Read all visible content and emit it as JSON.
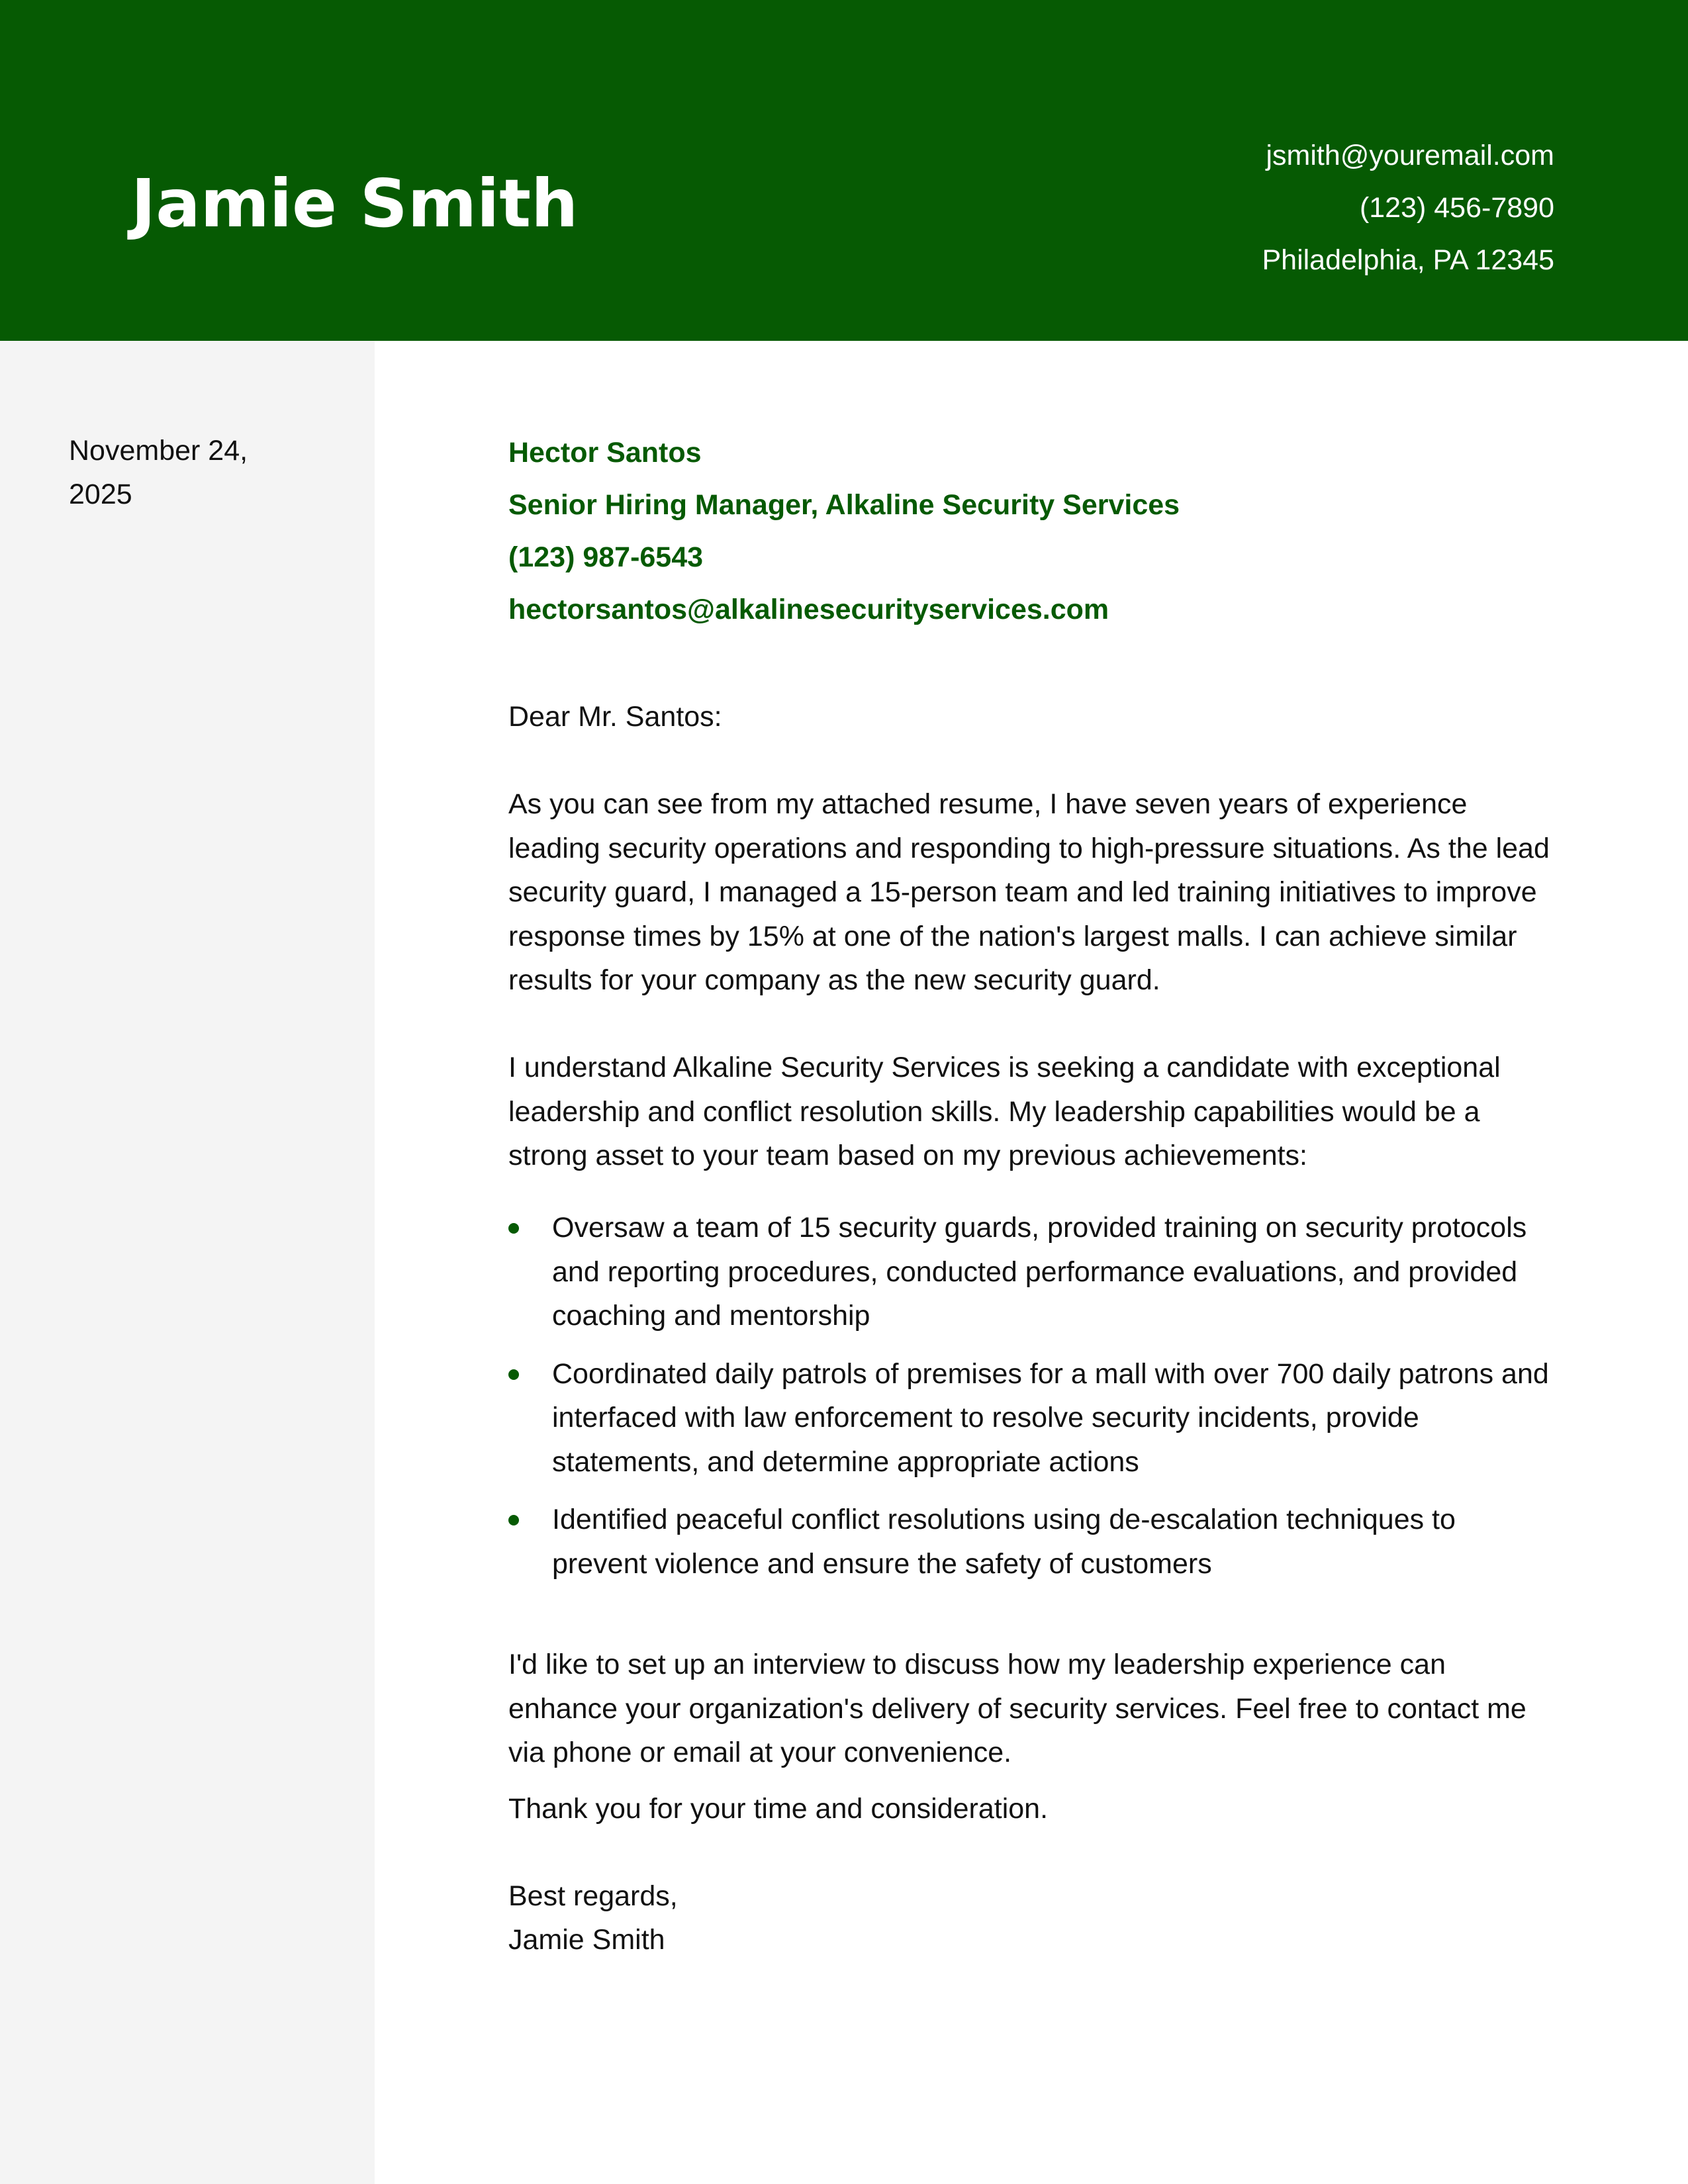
{
  "header": {
    "name": "Jamie Smith",
    "contact": {
      "email": "jsmith@youremail.com",
      "phone": "(123) 456-7890",
      "location": "Philadelphia, PA 12345"
    }
  },
  "sidebar": {
    "date": "November 24, 2025"
  },
  "recipient": {
    "name": "Hector Santos",
    "title": "Senior Hiring Manager, Alkaline Security Services",
    "phone": "(123) 987-6543",
    "email": "hectorsantos@alkalinesecurityservices.com"
  },
  "letter": {
    "greeting": "Dear Mr. Santos:",
    "paragraph1": "As you can see from my attached resume, I have seven years of experience leading security operations and responding to high-pressure situations. As the lead security guard, I managed a 15-person team and led training initiatives to improve response times by 15% at one of the nation's largest malls. I can achieve similar results for your company as the new security guard.",
    "paragraph2": "I understand Alkaline Security Services is seeking a candidate with exceptional leadership and conflict resolution skills. My leadership capabilities would be a strong asset to your team based on my previous achievements:",
    "bullets": [
      "Oversaw a team of 15 security guards, provided training on security protocols and reporting procedures, conducted performance evaluations, and provided coaching and mentorship",
      "Coordinated daily patrols of premises for a mall with over 700 daily patrons and interfaced with law enforcement to resolve security incidents, provide statements, and determine appropriate actions",
      "Identified peaceful conflict resolutions using de-escalation techniques to prevent violence and ensure the safety of customers"
    ],
    "paragraph3": "I'd like to set up an interview to discuss how my leadership experience can enhance your organization's delivery of security services. Feel free to contact me via phone or email at your convenience.",
    "paragraph4": "Thank you for your time and consideration.",
    "closing": "Best regards,",
    "signature": "Jamie Smith"
  },
  "colors": {
    "accent": "#065a03",
    "sidebar_bg": "#f4f4f4",
    "header_text": "#ffffff",
    "body_text": "#111111"
  }
}
